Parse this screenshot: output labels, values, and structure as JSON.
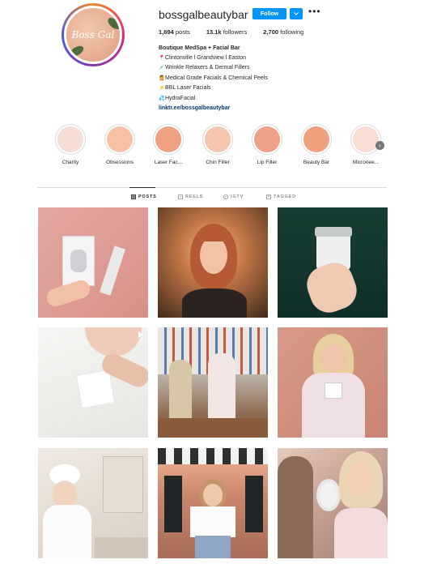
{
  "profile": {
    "username": "bossgalbeautybar",
    "follow_label": "Follow",
    "more_label": "•••",
    "avatar_text": "Boss Gal",
    "stats": [
      {
        "value": "1,694",
        "label": "posts"
      },
      {
        "value": "13.1k",
        "label": "followers"
      },
      {
        "value": "2,700",
        "label": "following"
      }
    ],
    "bio": {
      "name": "Boutique MedSpa + Facial Bar",
      "lines": [
        {
          "emoji": "📍",
          "text": "Clintonville l Grandview l Easton"
        },
        {
          "emoji": "💉",
          "text": "Wrinkle Relaxers & Dermal Fillers"
        },
        {
          "emoji": "💆",
          "text": "Medical Grade Facials & Chemical Peels"
        },
        {
          "emoji": "⚡",
          "text": "BBL Laser Facials"
        },
        {
          "emoji": "💦",
          "text": "HydraFacial"
        }
      ],
      "link": "linktr.ee/bossgalbeautybar"
    }
  },
  "highlights": [
    {
      "label": "Charity",
      "color": "#f6ddd3"
    },
    {
      "label": "Obsessions",
      "color": "#f7c3a7"
    },
    {
      "label": "Laser Fac...",
      "color": "#eea282"
    },
    {
      "label": "Chin Filler",
      "color": "#f6c5ad"
    },
    {
      "label": "Lip Filler",
      "color": "#eea184"
    },
    {
      "label": "Beauty Bar",
      "color": "#efa07f"
    },
    {
      "label": "Micronee...",
      "color": "#f7ddd2"
    }
  ],
  "tabs": [
    {
      "label": "POSTS",
      "active": true
    },
    {
      "label": "REELS",
      "active": false
    },
    {
      "label": "IGTV",
      "active": false
    },
    {
      "label": "TAGGED",
      "active": false
    }
  ],
  "posts": [
    {
      "desc": "skincare device and tube on pink background"
    },
    {
      "desc": "woman with red bangs portrait"
    },
    {
      "desc": "hand holding jar of cream"
    },
    {
      "desc": "facial mask application video"
    },
    {
      "desc": "two women in product store"
    },
    {
      "desc": "woman holding product box"
    },
    {
      "desc": "woman in robe and towel in bathroom"
    },
    {
      "desc": "woman in white top outside building"
    },
    {
      "desc": "woman looking into hand mirror"
    }
  ],
  "colors": {
    "accent": "#0095f6",
    "link": "#00376b",
    "text": "#262626",
    "muted": "#8e8e8e"
  }
}
